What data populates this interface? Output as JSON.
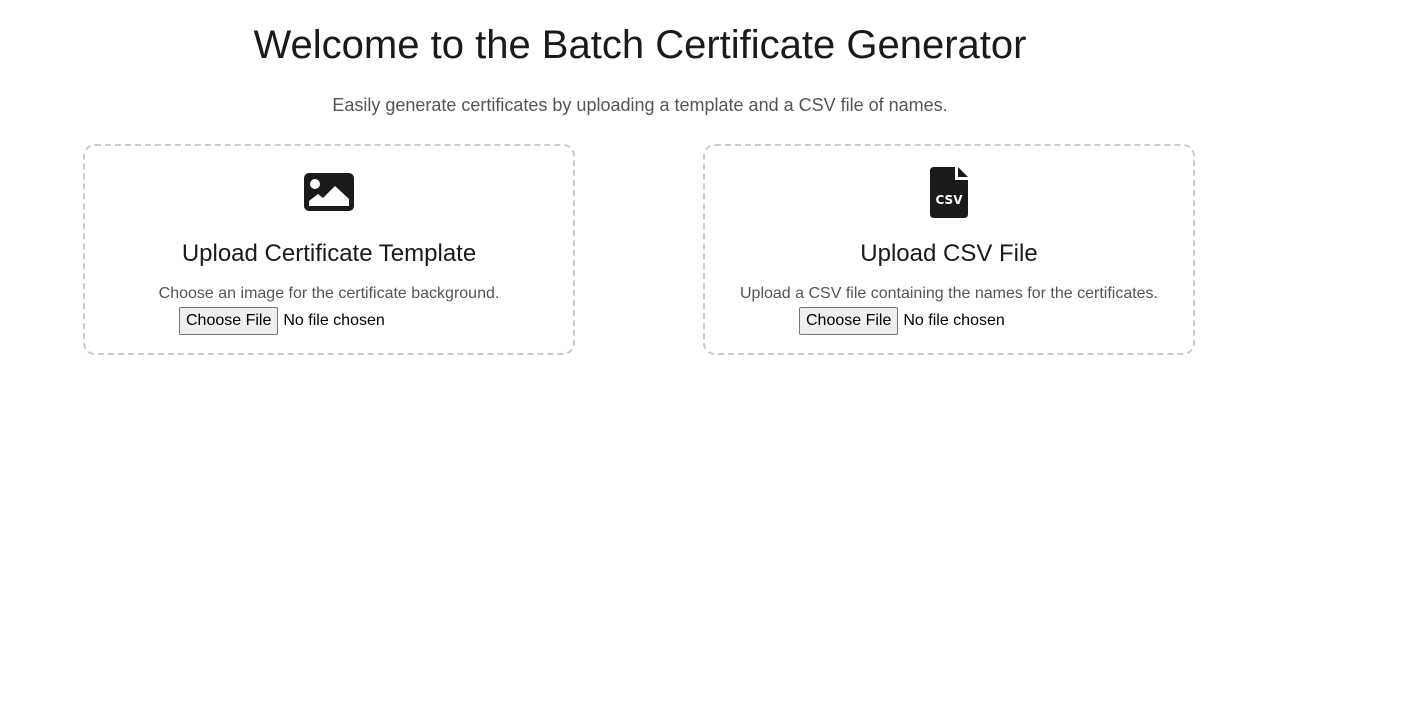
{
  "header": {
    "title": "Welcome to the Batch Certificate Generator",
    "subtitle": "Easily generate certificates by uploading a template and a CSV file of names."
  },
  "cards": [
    {
      "icon": "image-icon",
      "title": "Upload Certificate Template",
      "description": "Choose an image for the certificate background.",
      "button_label": "Choose File",
      "file_status": "No file chosen"
    },
    {
      "icon": "csv-file-icon",
      "icon_text": "CSV",
      "title": "Upload CSV File",
      "description": "Upload a CSV file containing the names for the certificates.",
      "button_label": "Choose File",
      "file_status": "No file chosen"
    }
  ],
  "colors": {
    "text": "#1a1a1a",
    "muted": "#555555",
    "card_border": "#cccccc",
    "icon": "#1a1a1a"
  }
}
